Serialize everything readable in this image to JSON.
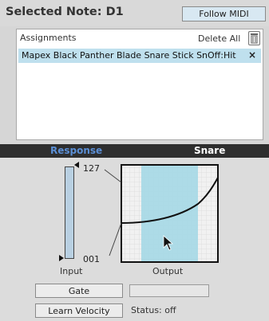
{
  "header": {
    "title": "Selected Note: D1",
    "follow_midi_label": "Follow MIDI"
  },
  "assignments": {
    "label": "Assignments",
    "delete_all_label": "Delete All",
    "delete_icon": "trash-icon",
    "items": [
      {
        "text": "Mapex Black Panther Blade Snare Stick SnOff:Hit",
        "remove_glyph": "×"
      }
    ]
  },
  "response": {
    "title": "Response",
    "instrument": "Snare"
  },
  "curve": {
    "input_max": "127",
    "input_min": "001",
    "input_label": "Input",
    "output_label": "Output",
    "colors": {
      "highlight": "#a9d9e6",
      "curve": "#111111"
    }
  },
  "controls": {
    "gate_label": "Gate",
    "learn_velocity_label": "Learn Velocity",
    "status_text": "Status: off"
  }
}
